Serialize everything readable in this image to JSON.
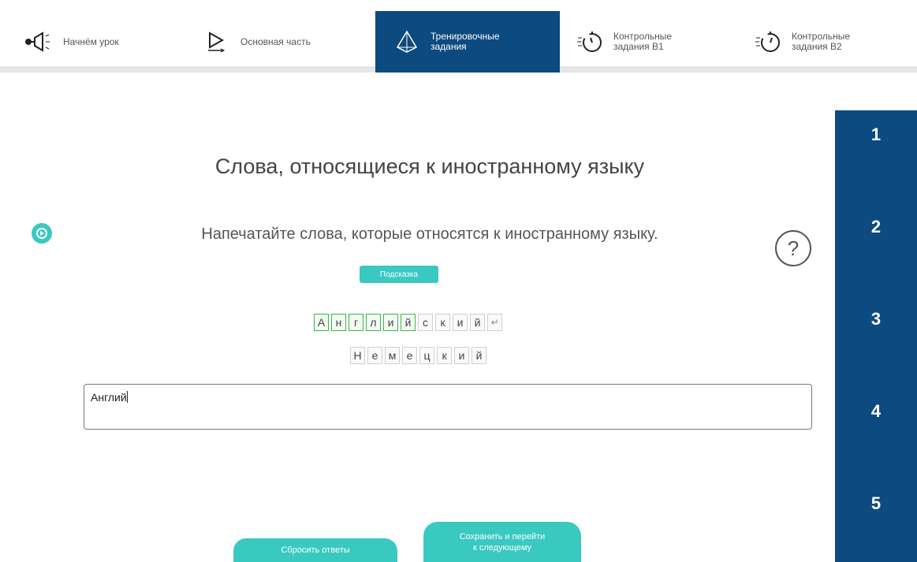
{
  "nav": {
    "items": [
      {
        "label": "Начнём урок",
        "icon": "megaphone-icon",
        "active": false
      },
      {
        "label": "Основная часть",
        "icon": "play-icon",
        "active": false
      },
      {
        "label": "Тренировочные\nзадания",
        "icon": "prism-icon",
        "active": true
      },
      {
        "label": "Контрольные\nзадания В1",
        "icon": "stopwatch-icon",
        "active": false
      },
      {
        "label": "Контрольные\nзадания В2",
        "icon": "stopwatch-icon",
        "active": false
      }
    ]
  },
  "sidebar": {
    "numbers": [
      "1",
      "2",
      "3",
      "4",
      "5"
    ]
  },
  "main": {
    "title": "Слова, относящиеся к иностранному языку",
    "instruction": "Напечатайте слова, которые относятся к иностранному языку.",
    "help_symbol": "?",
    "hint_label": "Подсказка",
    "letters_row1": [
      "А",
      "н",
      "г",
      "л",
      "и",
      "й",
      "с",
      "к",
      "и",
      "й",
      "↵"
    ],
    "letters_row1_used": [
      true,
      true,
      true,
      true,
      true,
      true,
      false,
      false,
      false,
      false,
      false
    ],
    "letters_row2": [
      "Н",
      "е",
      "м",
      "е",
      "ц",
      "к",
      "и",
      "й"
    ],
    "input_value": "Англий",
    "reset_label": "Сбросить ответы",
    "save_label": "Сохранить и перейти\nк следующему"
  },
  "colors": {
    "accent": "#39c9c0",
    "navy": "#0d4a80",
    "used_letter_border": "#39b54a"
  }
}
